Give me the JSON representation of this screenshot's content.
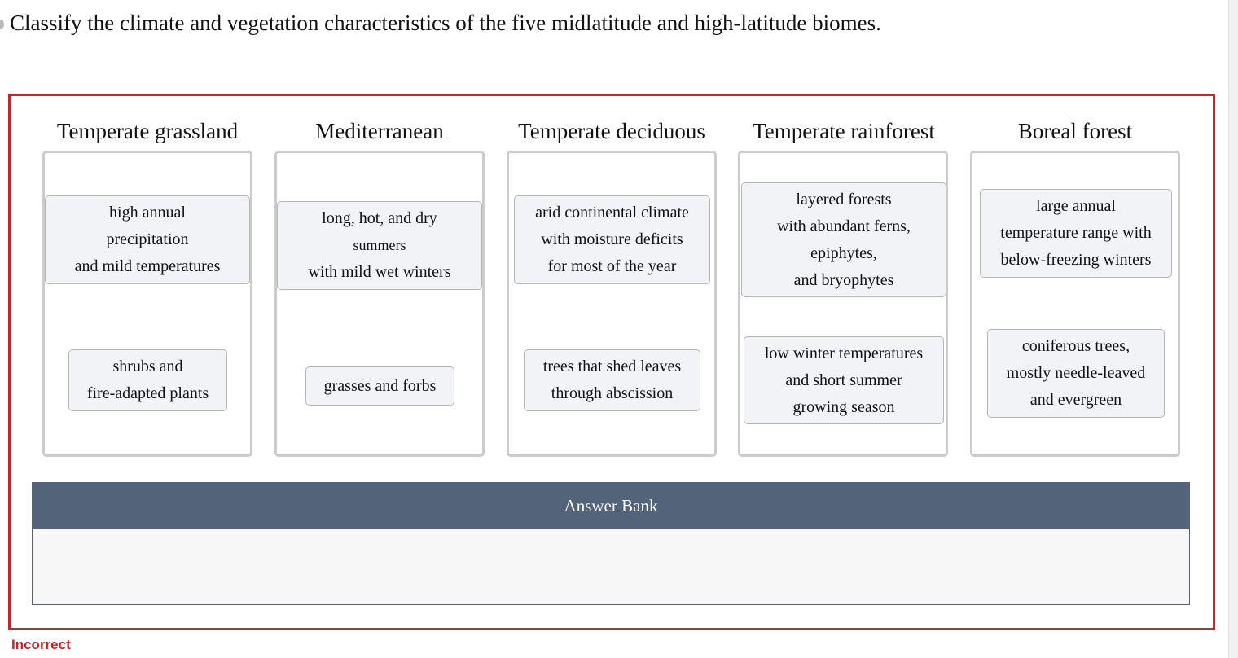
{
  "question": "Classify the climate and vegetation characteristics of the five midlatitude and high-latitude biomes.",
  "colors": {
    "error_border": "#c0282e",
    "bank_header": "#52637a",
    "card_bg": "#f2f3f6",
    "bin_border": "#cccccc"
  },
  "categories": [
    {
      "title": "Temperate grassland",
      "cards": [
        {
          "lines": [
            "high annual",
            "precipitation",
            "and mild temperatures"
          ]
        },
        {
          "lines": [
            "shrubs and",
            "fire-adapted plants"
          ]
        }
      ]
    },
    {
      "title": "Mediterranean",
      "cards": [
        {
          "lines": [
            "long, hot, and dry",
            "summers",
            "with mild wet winters"
          ]
        },
        {
          "lines": [
            "grasses and forbs"
          ]
        }
      ]
    },
    {
      "title": "Temperate deciduous",
      "cards": [
        {
          "lines": [
            "arid continental climate",
            "with moisture deficits",
            "for most of the year"
          ]
        },
        {
          "lines": [
            "trees that shed leaves",
            "through abscission"
          ]
        }
      ]
    },
    {
      "title": "Temperate rainforest",
      "cards": [
        {
          "lines": [
            "layered forests",
            "with abundant ferns,",
            "epiphytes,",
            "and bryophytes"
          ]
        },
        {
          "lines": [
            "low winter temperatures",
            "and short summer",
            "growing season"
          ]
        }
      ]
    },
    {
      "title": "Boreal forest",
      "cards": [
        {
          "lines": [
            "large annual",
            "temperature range with",
            "below-freezing winters"
          ]
        },
        {
          "lines": [
            "coniferous trees,",
            "mostly needle-leaved",
            "and evergreen"
          ]
        }
      ]
    }
  ],
  "answer_bank": {
    "title": "Answer Bank",
    "items": []
  },
  "status": "Incorrect"
}
